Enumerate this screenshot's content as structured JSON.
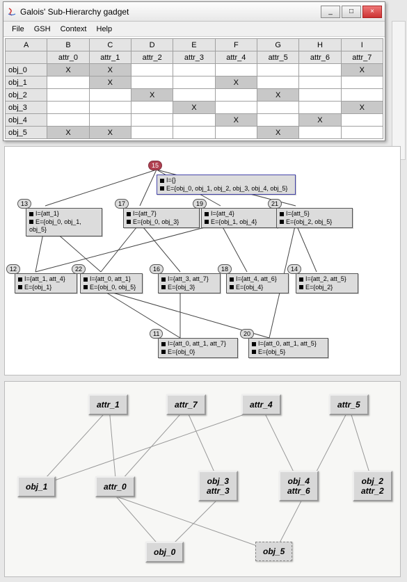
{
  "window": {
    "title": "Galois' Sub-Hierarchy gadget",
    "buttons": {
      "min": "_",
      "max": "□",
      "close": "×"
    }
  },
  "menubar": {
    "items": [
      "File",
      "GSH",
      "Context",
      "Help"
    ]
  },
  "table": {
    "col_heads": [
      "A",
      "B",
      "C",
      "D",
      "E",
      "F",
      "G",
      "H",
      "I"
    ],
    "attr_heads": [
      "",
      "attr_0",
      "attr_1",
      "attr_2",
      "attr_3",
      "attr_4",
      "attr_5",
      "attr_6",
      "attr_7"
    ],
    "rows": [
      {
        "name": "obj_0",
        "cells": [
          "X",
          "X",
          "",
          "",
          "",
          "",
          "",
          "X"
        ]
      },
      {
        "name": "obj_1",
        "cells": [
          "",
          "X",
          "",
          "",
          "X",
          "",
          "",
          ""
        ]
      },
      {
        "name": "obj_2",
        "cells": [
          "",
          "",
          "X",
          "",
          "",
          "X",
          "",
          ""
        ]
      },
      {
        "name": "obj_3",
        "cells": [
          "",
          "",
          "",
          "X",
          "",
          "",
          "",
          "X"
        ]
      },
      {
        "name": "obj_4",
        "cells": [
          "",
          "",
          "",
          "",
          "X",
          "",
          "X",
          ""
        ]
      },
      {
        "name": "obj_5",
        "cells": [
          "X",
          "X",
          "",
          "",
          "",
          "X",
          "",
          ""
        ]
      }
    ]
  },
  "lattice": {
    "root": {
      "id": "15",
      "I": "I={}",
      "E": "E={obj_0, obj_1, obj_2, obj_3, obj_4, obj_5}"
    },
    "row1": [
      {
        "id": "13",
        "I": "I={att_1}",
        "E": "E={obj_0, obj_1, obj_5}"
      },
      {
        "id": "17",
        "I": "I={att_7}",
        "E": "E={obj_0, obj_3}"
      },
      {
        "id": "19",
        "I": "I={att_4}",
        "E": "E={obj_1, obj_4}"
      },
      {
        "id": "21",
        "I": "I={att_5}",
        "E": "E={obj_2, obj_5}"
      }
    ],
    "row2": [
      {
        "id": "12",
        "I": "I={att_1, att_4}",
        "E": "E={obj_1}"
      },
      {
        "id": "22",
        "I": "I={att_0, att_1}",
        "E": "E={obj_0, obj_5}"
      },
      {
        "id": "16",
        "I": "I={att_3, att_7}",
        "E": "E={obj_3}"
      },
      {
        "id": "18",
        "I": "I={att_4, att_6}",
        "E": "E={obj_4}"
      },
      {
        "id": "14",
        "I": "I={att_2, att_5}",
        "E": "E={obj_2}"
      }
    ],
    "row3": [
      {
        "id": "11",
        "I": "I={att_0, att_1, att_7}",
        "E": "E={obj_0}"
      },
      {
        "id": "20",
        "I": "I={att_0, att_1, att_5}",
        "E": "E={obj_5}"
      }
    ]
  },
  "graph2": {
    "top": [
      {
        "label": "attr_1"
      },
      {
        "label": "attr_7"
      },
      {
        "label": "attr_4"
      },
      {
        "label": "attr_5"
      }
    ],
    "mid": [
      {
        "label": "obj_1"
      },
      {
        "label": "attr_0"
      },
      {
        "l1": "obj_3",
        "l2": "attr_3"
      },
      {
        "l1": "obj_4",
        "l2": "attr_6"
      },
      {
        "l1": "obj_2",
        "l2": "attr_2"
      }
    ],
    "bot": [
      {
        "label": "obj_0"
      },
      {
        "label": "obj_5"
      }
    ]
  }
}
